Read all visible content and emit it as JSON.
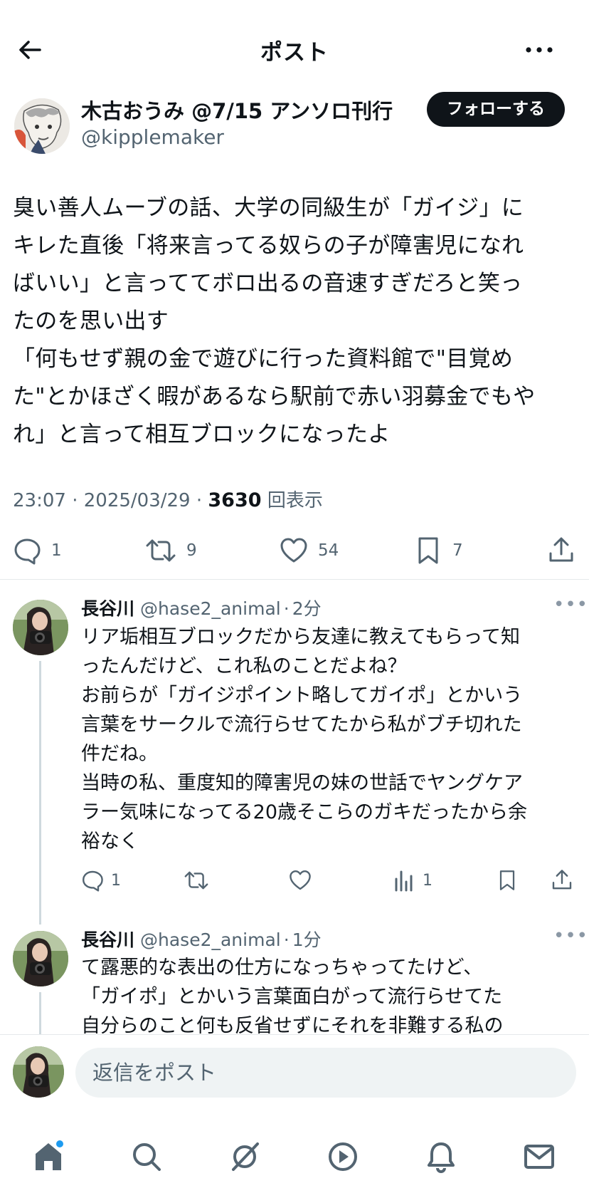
{
  "header": {
    "title": "ポスト"
  },
  "post": {
    "author_name": "木古おうみ @7/15 アンソロ刊行",
    "author_handle": "@kipplemaker",
    "follow_label": "フォローする",
    "body_lines": [
      "臭い善人ムーブの話、大学の同級生が「ガイジ」に",
      "キレた直後「将来言ってる奴らの子が障害児になれ",
      "ばいい」と言っててボロ出るの音速すぎだろと笑っ",
      "たのを思い出す",
      "「何もせず親の金で遊びに行った資料館で\"目覚め",
      "た\"とかほざく暇があるなら駅前で赤い羽募金でもや",
      "れ」と言って相互ブロックになったよ"
    ],
    "time": "23:07",
    "date": "2025/03/29",
    "views": "3630",
    "views_label": "回表示",
    "replies": "1",
    "reposts": "9",
    "likes": "54",
    "bookmarks": "7"
  },
  "replies": [
    {
      "name": "長谷川",
      "handle": "@hase2_animal",
      "time": "2分",
      "lines": [
        "リア垢相互ブロックだから友達に教えてもらって知",
        "ったんだけど、これ私のことだよね？",
        "お前らが「ガイジポイント略してガイポ」とかいう",
        "言葉をサークルで流行らせてたから私がブチ切れた",
        "件だね。",
        "当時の私、重度知的障害児の妹の世話でヤングケア",
        "ラー気味になってる20歳そこらのガキだったから余",
        "裕なく"
      ],
      "reply_count": "1",
      "view_count": "1"
    },
    {
      "name": "長谷川",
      "handle": "@hase2_animal",
      "time": "1分",
      "lines": [
        "て露悪的な表出の仕方になっちゃってたけど、",
        "「ガイポ」とかいう言葉面白がって流行らせてた",
        "自分らのこと何も反省せずにそれを非難する私の"
      ]
    }
  ],
  "compose": {
    "placeholder": "返信をポスト"
  },
  "colors": {
    "text": "#0f1419",
    "secondary": "#536471",
    "accent": "#1d9bf0",
    "button": "#0f1419"
  },
  "tabs": [
    "home-icon",
    "search-icon",
    "grok-icon",
    "video-icon",
    "notifications-icon",
    "messages-icon"
  ]
}
